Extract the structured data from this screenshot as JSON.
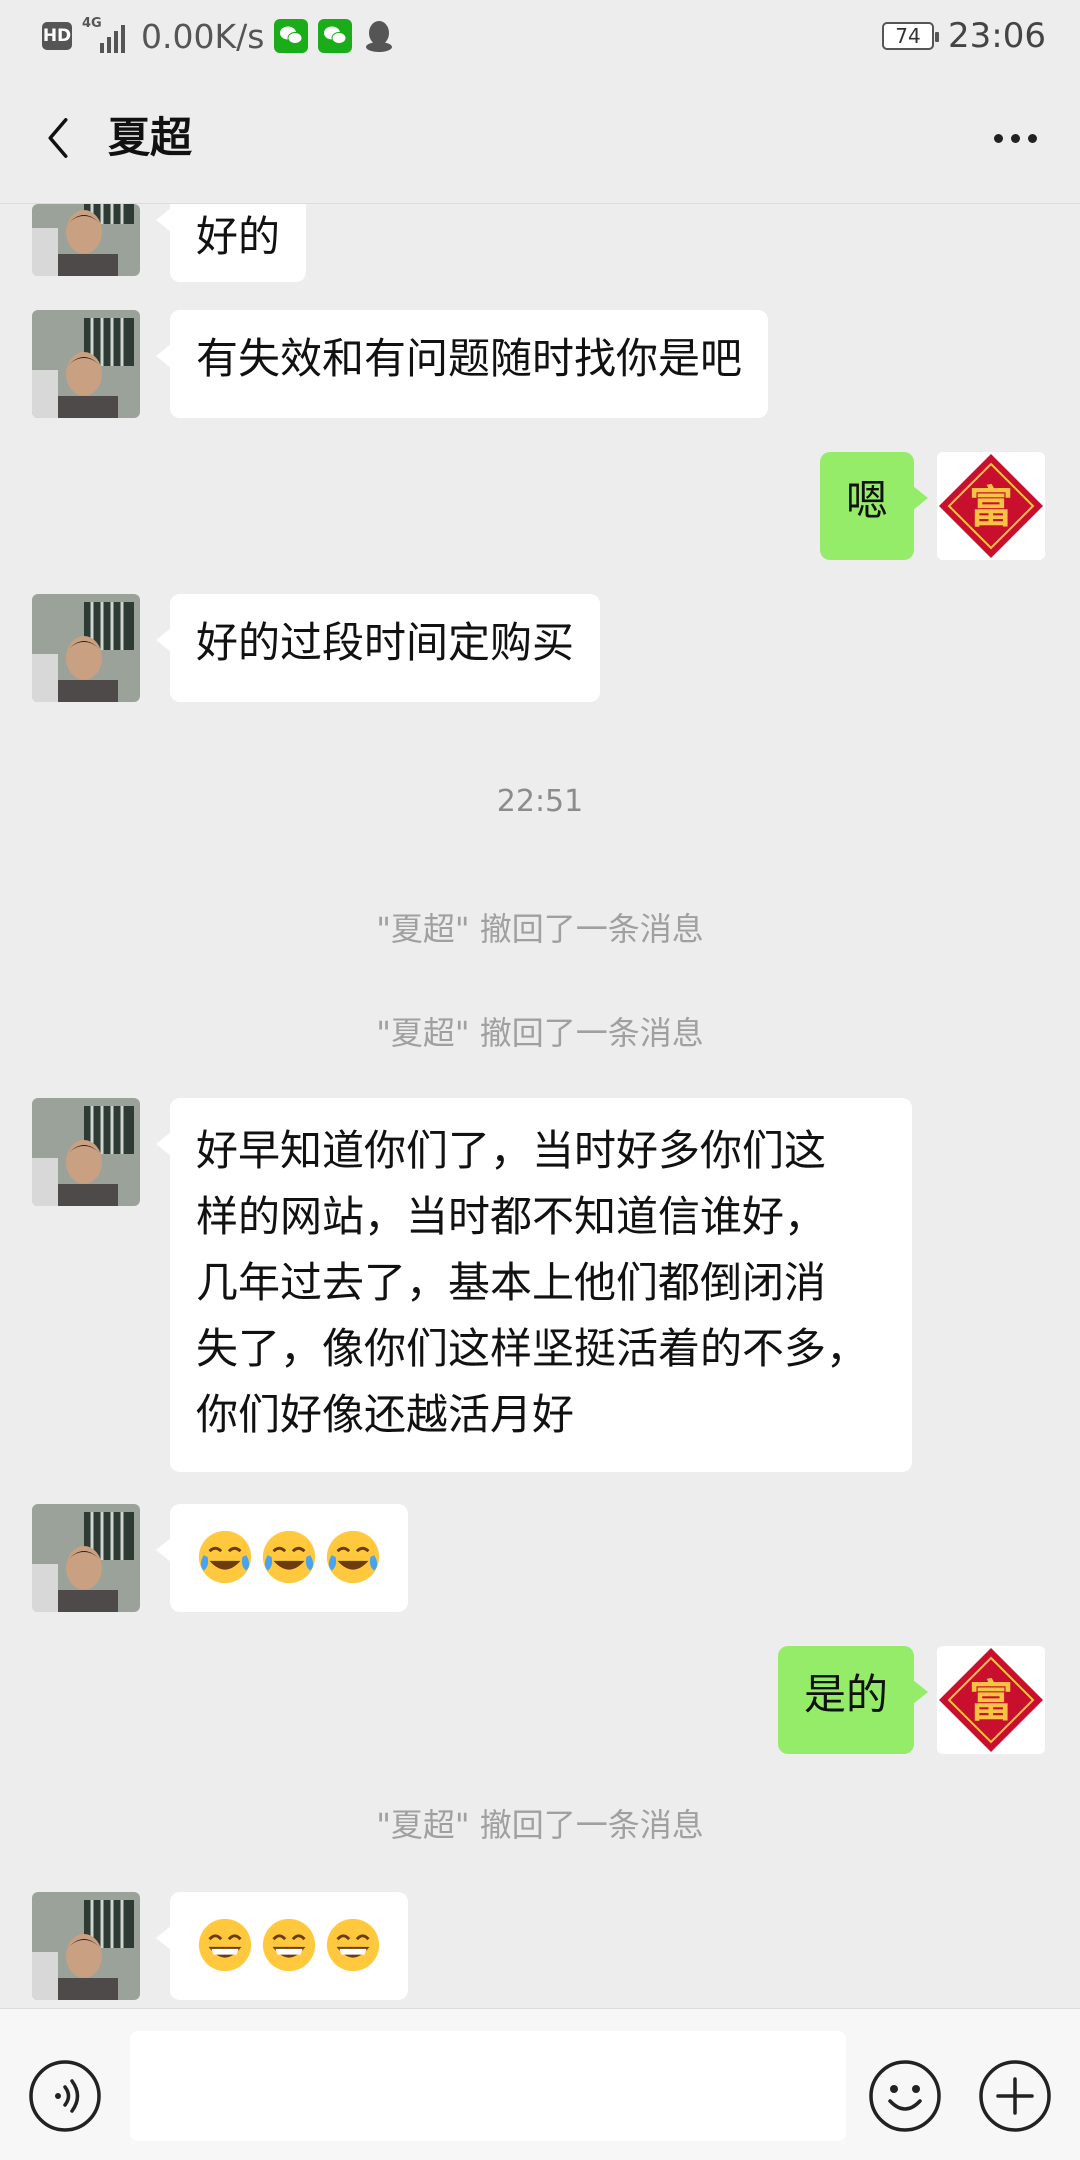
{
  "status_bar": {
    "hd": "HD",
    "network": "4G",
    "speed": "0.00K/s",
    "battery": "74",
    "time": "23:06"
  },
  "header": {
    "title": "夏超"
  },
  "messages": {
    "m1": "好的",
    "m2": "有失效和有问题随时找你是吧",
    "m3": "嗯",
    "m4": "好的过段时间定购买",
    "ts1": "22:51",
    "recall1": "\"夏超\" 撤回了一条消息",
    "recall2": "\"夏超\" 撤回了一条消息",
    "m5_lines": [
      "好早知道你们了，当时好多你们这",
      "样的网站，当时都不知道信谁好，",
      "几年过去了，基本上他们都倒闭消",
      "失了，像你们这样坚挺活着的不多，",
      "你们好像还越活月好"
    ],
    "m6_emojis": [
      "crying-laughing-emoji",
      "crying-laughing-emoji",
      "crying-laughing-emoji"
    ],
    "m7": "是的",
    "recall3": "\"夏超\" 撤回了一条消息",
    "m8_emojis": [
      "grinning-emoji",
      "grinning-emoji",
      "grinning-emoji"
    ]
  },
  "colors": {
    "background": "#ededed",
    "outgoing_bubble": "#95ec69",
    "incoming_bubble": "#ffffff",
    "wechat_green": "#1aad19",
    "fu_red": "#c8102e",
    "fu_gold": "#f6c343"
  },
  "icons": {
    "back": "chevron-left-icon",
    "more": "more-dots-icon",
    "voice": "voice-icon",
    "emoji": "emoji-icon",
    "plus": "plus-icon"
  },
  "bottom_bar": {
    "input_placeholder": ""
  }
}
